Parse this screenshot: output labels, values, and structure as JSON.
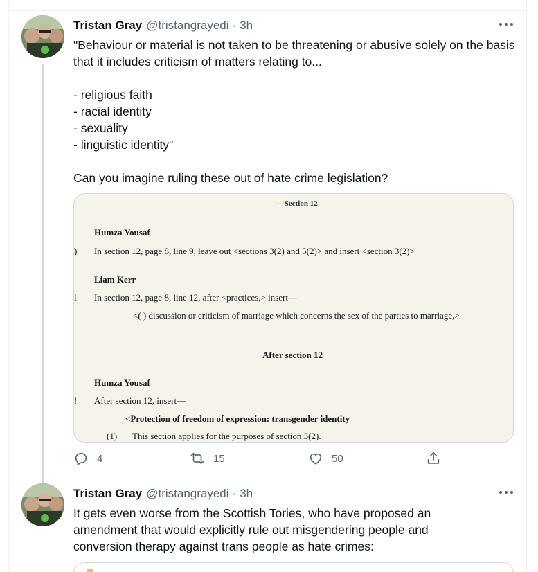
{
  "tweets": [
    {
      "name": "Tristan Gray",
      "handle": "@tristangrayedi",
      "separator": "·",
      "time": "3h",
      "text": "\"Behaviour or material is not taken to be threatening or abusive solely on the basis that it includes criticism of matters relating to...\n\n- religious faith\n- racial identity\n- sexuality\n- linguistic identity\"\n\nCan you imagine ruling these out of hate crime legislation?",
      "image": {
        "top_fragment": "— Section 12",
        "entries": [
          {
            "heading": "Humza Yousaf",
            "marker": ")",
            "text": "In section 12, page 8, line 9, leave out <sections 3(2) and 5(2)> and insert <section 3(2)>"
          },
          {
            "heading": "Liam Kerr",
            "marker": "l",
            "text": "In section 12, page 8, line 12, after <practices,> insert—"
          }
        ],
        "indented": "<( )   discussion or criticism of marriage which concerns the sex of the parties to marriage,>",
        "subsection": "After section 12",
        "entry3_heading": "Humza Yousaf",
        "entry3_marker": "!",
        "entry3_text": "After section 12, insert—",
        "protection": "<Protection of freedom of expression: transgender identity",
        "clause_num": "(1)",
        "clause_text": "This section applies for the purposes of section 3(2)."
      },
      "actions": {
        "replies": "4",
        "retweets": "15",
        "likes": "50"
      }
    },
    {
      "name": "Tristan Gray",
      "handle": "@tristangrayedi",
      "separator": "·",
      "time": "3h",
      "text": "It gets even worse from the Scottish Tories, who have proposed an amendment that would explicitly rule out misgendering people and conversion therapy against trans people as hate crimes:"
    }
  ],
  "icons": {
    "more": "more-icon",
    "reply": "reply-icon",
    "retweet": "retweet-icon",
    "like": "like-icon",
    "share": "share-icon"
  },
  "colors": {
    "text": "#0f1419",
    "secondary": "#536471",
    "border": "#cfd9de",
    "doc_background": "#f5f3ea"
  }
}
